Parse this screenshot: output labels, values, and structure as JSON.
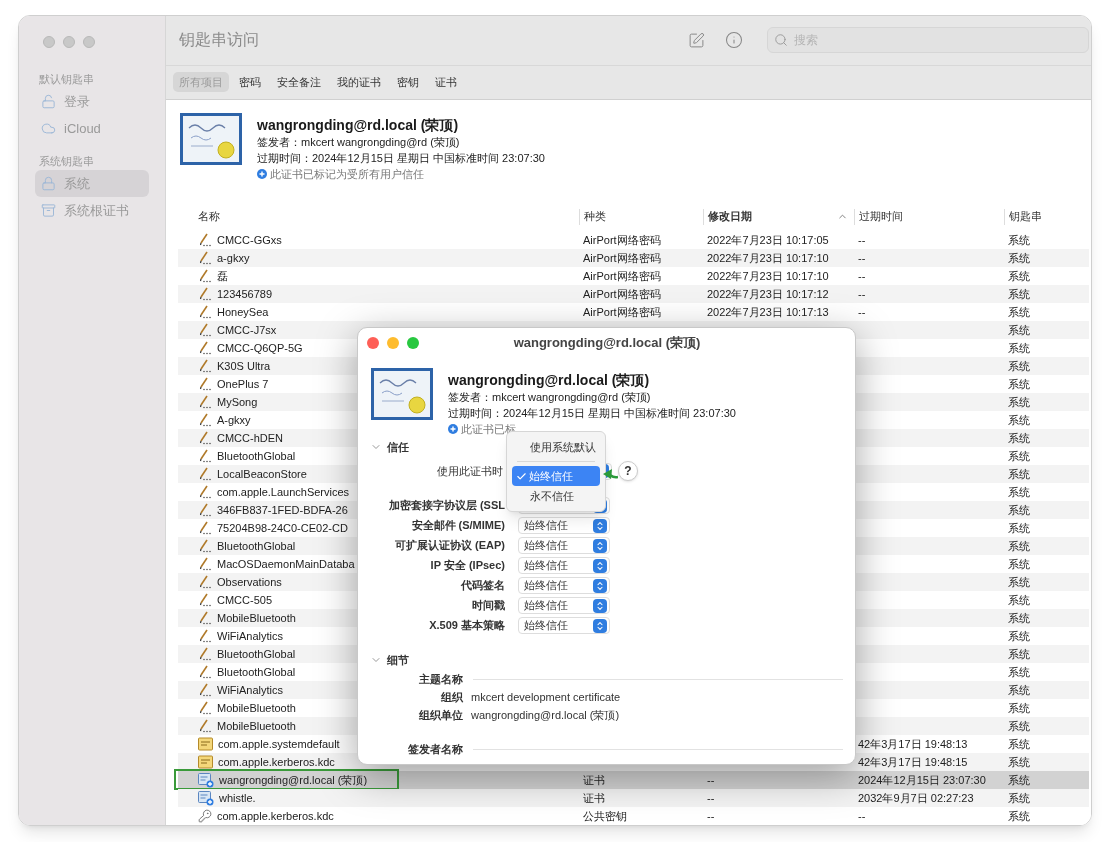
{
  "window": {
    "title": "钥匙串访问",
    "search": {
      "placeholder": "搜索"
    }
  },
  "sidebar": {
    "sections": [
      {
        "heading": "默认钥匙串",
        "items": [
          {
            "label": "登录",
            "kind": "lock-open",
            "selected": false
          },
          {
            "label": "iCloud",
            "kind": "cloud",
            "selected": false
          }
        ]
      },
      {
        "heading": "系统钥匙串",
        "items": [
          {
            "label": "系统",
            "kind": "lock",
            "selected": true
          },
          {
            "label": "系统根证书",
            "kind": "cabinet",
            "selected": false
          }
        ]
      }
    ]
  },
  "tabs": [
    {
      "label": "所有项目",
      "selected": true
    },
    {
      "label": "密码",
      "selected": false
    },
    {
      "label": "安全备注",
      "selected": false
    },
    {
      "label": "我的证书",
      "selected": false
    },
    {
      "label": "密钥",
      "selected": false
    },
    {
      "label": "证书",
      "selected": false
    }
  ],
  "summary": {
    "title": "wangrongding@rd.local (荣顶)",
    "issuer": "签发者：mkcert wangrongding@rd (荣顶)",
    "expires": "过期时间：2024年12月15日 星期日 中国标准时间 23:07:30",
    "trust": "此证书已标记为受所有用户信任"
  },
  "table": {
    "columns": [
      {
        "label": "名称",
        "sorted": false
      },
      {
        "label": "种类",
        "sorted": false
      },
      {
        "label": "修改日期",
        "sorted": true
      },
      {
        "label": "过期时间",
        "sorted": false
      },
      {
        "label": "钥匙串",
        "sorted": false
      }
    ],
    "rows": [
      {
        "kind": "password",
        "name": "CMCC-GGxs",
        "type": "AirPort网络密码",
        "modified": "2022年7月23日 10:17:05",
        "expires": "--",
        "keychain": "系统",
        "selected": false,
        "highlighted": false
      },
      {
        "kind": "password",
        "name": "a-gkxy",
        "type": "AirPort网络密码",
        "modified": "2022年7月23日 10:17:10",
        "expires": "--",
        "keychain": "系统",
        "selected": false,
        "highlighted": false
      },
      {
        "kind": "password",
        "name": "磊",
        "type": "AirPort网络密码",
        "modified": "2022年7月23日 10:17:10",
        "expires": "--",
        "keychain": "系统",
        "selected": false,
        "highlighted": false
      },
      {
        "kind": "password",
        "name": "123456789",
        "type": "AirPort网络密码",
        "modified": "2022年7月23日 10:17:12",
        "expires": "--",
        "keychain": "系统",
        "selected": false,
        "highlighted": false
      },
      {
        "kind": "password",
        "name": "HoneySea",
        "type": "AirPort网络密码",
        "modified": "2022年7月23日 10:17:13",
        "expires": "--",
        "keychain": "系统",
        "selected": false,
        "highlighted": false
      },
      {
        "kind": "password",
        "name": "CMCC-J7sx",
        "keychain": "系统",
        "selected": false,
        "highlighted": false
      },
      {
        "kind": "password",
        "name": "CMCC-Q6QP-5G",
        "keychain": "系统",
        "selected": false,
        "highlighted": false
      },
      {
        "kind": "password",
        "name": "K30S Ultra",
        "keychain": "系统",
        "selected": false,
        "highlighted": false
      },
      {
        "kind": "password",
        "name": "OnePlus 7",
        "keychain": "系统",
        "selected": false,
        "highlighted": false
      },
      {
        "kind": "password",
        "name": "MySong",
        "keychain": "系统",
        "selected": false,
        "highlighted": false
      },
      {
        "kind": "password",
        "name": "A-gkxy",
        "keychain": "系统",
        "selected": false,
        "highlighted": false
      },
      {
        "kind": "password",
        "name": "CMCC-hDEN",
        "keychain": "系统",
        "selected": false,
        "highlighted": false
      },
      {
        "kind": "password",
        "name": "BluetoothGlobal",
        "keychain": "系统",
        "selected": false,
        "highlighted": false
      },
      {
        "kind": "password",
        "name": "LocalBeaconStore",
        "keychain": "系统",
        "selected": false,
        "highlighted": false
      },
      {
        "kind": "password",
        "name": "com.apple.LaunchServices",
        "keychain": "系统",
        "selected": false,
        "highlighted": false
      },
      {
        "kind": "password",
        "name": "346FB837-1FED-BDFA-26",
        "keychain": "系统",
        "selected": false,
        "highlighted": false
      },
      {
        "kind": "password",
        "name": "75204B98-24C0-CE02-CD",
        "keychain": "系统",
        "selected": false,
        "highlighted": false
      },
      {
        "kind": "password",
        "name": "BluetoothGlobal",
        "keychain": "系统",
        "selected": false,
        "highlighted": false
      },
      {
        "kind": "password",
        "name": "MacOSDaemonMainDataba",
        "keychain": "系统",
        "selected": false,
        "highlighted": false
      },
      {
        "kind": "password",
        "name": "Observations",
        "keychain": "系统",
        "selected": false,
        "highlighted": false
      },
      {
        "kind": "password",
        "name": "CMCC-505",
        "keychain": "系统",
        "selected": false,
        "highlighted": false
      },
      {
        "kind": "password",
        "name": "MobileBluetooth",
        "keychain": "系统",
        "selected": false,
        "highlighted": false
      },
      {
        "kind": "password",
        "name": "WiFiAnalytics",
        "keychain": "系统",
        "selected": false,
        "highlighted": false
      },
      {
        "kind": "password",
        "name": "BluetoothGlobal",
        "keychain": "系统",
        "selected": false,
        "highlighted": false
      },
      {
        "kind": "password",
        "name": "BluetoothGlobal",
        "keychain": "系统",
        "selected": false,
        "highlighted": false
      },
      {
        "kind": "password",
        "name": "WiFiAnalytics",
        "keychain": "系统",
        "selected": false,
        "highlighted": false
      },
      {
        "kind": "password",
        "name": "MobileBluetooth",
        "keychain": "系统",
        "selected": false,
        "highlighted": false
      },
      {
        "kind": "password",
        "name": "MobileBluetooth",
        "keychain": "系统",
        "selected": false,
        "highlighted": false
      },
      {
        "kind": "certificate",
        "name": "com.apple.systemdefault",
        "expires": "42年3月17日 19:48:13",
        "keychain": "系统",
        "selected": false,
        "highlighted": false
      },
      {
        "kind": "certificate",
        "name": "com.apple.kerberos.kdc",
        "expires": "42年3月17日 19:48:15",
        "keychain": "系统",
        "selected": false,
        "highlighted": false
      },
      {
        "kind": "trusted-certificate",
        "name": "wangrongding@rd.local (荣顶)",
        "type": "证书",
        "modified": "--",
        "expires": "2024年12月15日 23:07:30",
        "keychain": "系统",
        "selected": true,
        "highlighted": true
      },
      {
        "kind": "trusted-certificate",
        "name": "whistle.",
        "type": "证书",
        "modified": "--",
        "expires": "2032年9月7日 02:27:23",
        "keychain": "系统",
        "selected": false,
        "highlighted": false
      },
      {
        "kind": "key",
        "name": "com.apple.kerberos.kdc",
        "type": "公共密钥",
        "modified": "--",
        "expires": "--",
        "keychain": "系统",
        "selected": false,
        "highlighted": false
      }
    ]
  },
  "dialog": {
    "title": "wangrongding@rd.local (荣顶)",
    "summary": {
      "title": "wangrongding@rd.local (荣顶)",
      "issuer": "签发者：mkcert wangrongding@rd (荣顶)",
      "expires": "过期时间：2024年12月15日 星期日 中国标准时间 23:07:30",
      "trust": "此证书已标"
    },
    "trust": {
      "heading": "信任",
      "expanded": true,
      "usage_label": "使用此证书时",
      "help": "?",
      "menu": [
        {
          "label": "使用系统默认",
          "selected": false
        },
        {
          "label": "始终信任",
          "selected": true
        },
        {
          "label": "永不信任",
          "selected": false
        }
      ],
      "policies": [
        {
          "label": "加密套接字协议层 (SSL"
        },
        {
          "label": "安全邮件 (S/MIME)",
          "value": "始终信任"
        },
        {
          "label": "可扩展认证协议 (EAP)",
          "value": "始终信任"
        },
        {
          "label": "IP 安全 (IPsec)",
          "value": "始终信任"
        },
        {
          "label": "代码签名",
          "value": "始终信任"
        },
        {
          "label": "时间戳",
          "value": "始终信任"
        },
        {
          "label": "X.509 基本策略",
          "value": "始终信任"
        }
      ]
    },
    "details": {
      "heading": "细节",
      "expanded": true,
      "groups": [
        {
          "heading": "主题名称",
          "fields": [
            {
              "label": "组织",
              "value": "mkcert development certificate"
            },
            {
              "label": "组织单位",
              "value": "wangrongding@rd.local (荣顶)"
            }
          ]
        },
        {
          "heading": "签发者名称"
        }
      ]
    }
  }
}
